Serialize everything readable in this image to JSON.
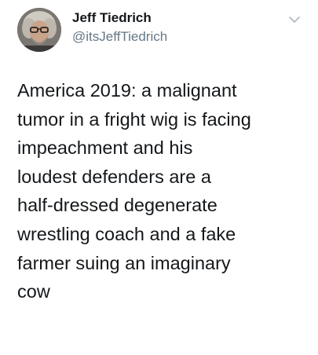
{
  "tweet": {
    "author": {
      "display_name": "Jeff Tiedrich",
      "handle": "@itsJeffTiedrich",
      "avatar_icon": "profile-photo"
    },
    "menu_icon": "chevron-down-icon",
    "text": "America 2019: a malignant\ntumor in a fright wig is facing\nimpeachment and his\nloudest defenders are a\nhalf-dressed degenerate\nwrestling coach and a fake\nfarmer suing an imaginary\ncow"
  },
  "colors": {
    "text": "#14171a",
    "secondary_text": "#657786",
    "background": "#ffffff"
  }
}
